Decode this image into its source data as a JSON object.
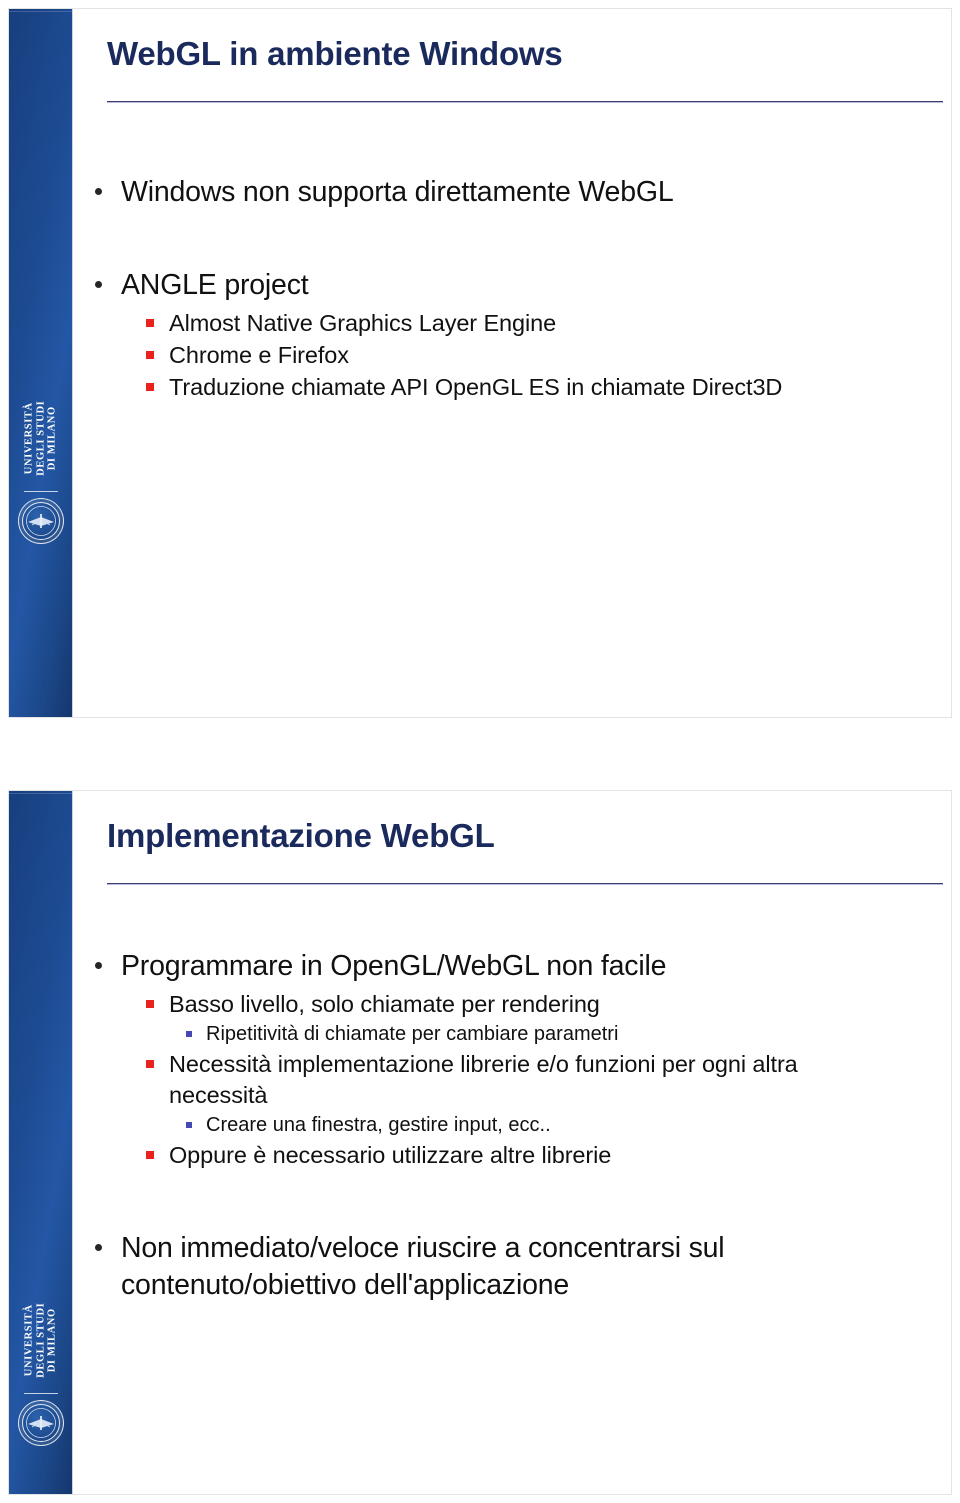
{
  "deck": {
    "logo": {
      "line1": "UNIVERSITÀ",
      "line2": "DEGLI STUDI",
      "line3": "DI MILANO",
      "seal_name": "university-seal"
    }
  },
  "slides": [
    {
      "title": "WebGL in ambiente Windows",
      "bullets": [
        {
          "level": 1,
          "text": "Windows non supporta direttamente WebGL"
        },
        {
          "level": 1,
          "text": "ANGLE project"
        },
        {
          "level": 2,
          "text": "Almost Native Graphics Layer Engine"
        },
        {
          "level": 2,
          "text": "Chrome e Firefox"
        },
        {
          "level": 2,
          "text": "Traduzione chiamate API OpenGL ES in chiamate Direct3D"
        }
      ]
    },
    {
      "title": "Implementazione WebGL",
      "bullets": [
        {
          "level": 1,
          "text": "Programmare in OpenGL/WebGL non facile"
        },
        {
          "level": 2,
          "text": "Basso livello, solo chiamate per rendering"
        },
        {
          "level": 3,
          "text": "Ripetitività di chiamate per cambiare parametri"
        },
        {
          "level": 2,
          "text": "Necessità implementazione librerie e/o funzioni per ogni altra necessità"
        },
        {
          "level": 3,
          "text": "Creare una finestra, gestire input, ecc.."
        },
        {
          "level": 2,
          "text": "Oppure è necessario utilizzare altre librerie"
        },
        {
          "level": 1,
          "text": "Non immediato/veloce riuscire a concentrarsi sul contenuto/obiettivo dell'applicazione"
        }
      ]
    }
  ],
  "colors": {
    "band_blue": "#1d4b92",
    "title_navy": "#1b2a5c",
    "bullet_red": "#e8231d",
    "bullet_blue": "#4648b4",
    "body_black": "#111111"
  }
}
